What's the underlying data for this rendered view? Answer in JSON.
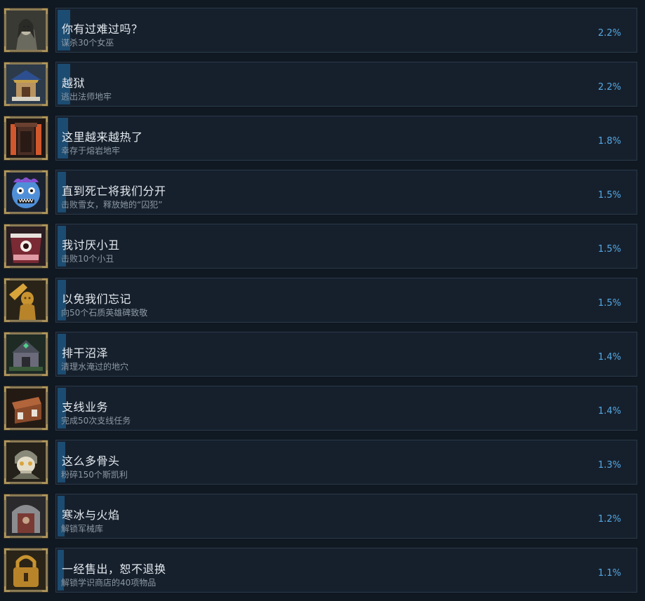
{
  "achievements": [
    {
      "title": "你有过难过吗？",
      "description": "谋杀30个女巫",
      "percent": "2.2%",
      "percent_value": 2.2,
      "icon": "witch-hunter-portrait-icon"
    },
    {
      "title": "越狱",
      "description": "逃出法师地牢",
      "percent": "2.2%",
      "percent_value": 2.2,
      "icon": "pagoda-building-icon"
    },
    {
      "title": "这里越来越热了",
      "description": "幸存于熔岩地牢",
      "percent": "1.8%",
      "percent_value": 1.8,
      "icon": "lava-dungeon-gate-icon"
    },
    {
      "title": "直到死亡将我们分开",
      "description": "击败雪女，释放她的“囚犯”",
      "percent": "1.5%",
      "percent_value": 1.5,
      "icon": "blue-monster-face-icon"
    },
    {
      "title": "我讨厌小丑",
      "description": "击败10个小丑",
      "percent": "1.5%",
      "percent_value": 1.5,
      "icon": "eye-monster-clown-icon"
    },
    {
      "title": "以免我们忘记",
      "description": "向50个石质英雄碑致敬",
      "percent": "1.5%",
      "percent_value": 1.5,
      "icon": "golden-hero-statue-icon"
    },
    {
      "title": "排干沼泽",
      "description": "清理水淹过的地穴",
      "percent": "1.4%",
      "percent_value": 1.4,
      "icon": "swamp-crypt-house-icon"
    },
    {
      "title": "支线业务",
      "description": "完成50次支线任务",
      "percent": "1.4%",
      "percent_value": 1.4,
      "icon": "wooden-chest-icon"
    },
    {
      "title": "这么多骨头",
      "description": "粉碎150个斯凯利",
      "percent": "1.3%",
      "percent_value": 1.3,
      "icon": "skeleton-warrior-icon"
    },
    {
      "title": "寒冰与火焰",
      "description": "解锁军械库",
      "percent": "1.2%",
      "percent_value": 1.2,
      "icon": "armory-door-icon"
    },
    {
      "title": "一经售出，恕不退换",
      "description": "解锁学识商店的40项物品",
      "percent": "1.1%",
      "percent_value": 1.1,
      "icon": "golden-padlock-icon"
    }
  ],
  "colors": {
    "background": "#101822",
    "bar_bg": "#16202d",
    "bar_border": "#2b3a4a",
    "progress_fill": "#1c4c71",
    "percent_text": "#56a9e2",
    "title_text": "#e4e9ee",
    "description_text": "#8c98a4",
    "icon_frame": "#8a7a55"
  }
}
